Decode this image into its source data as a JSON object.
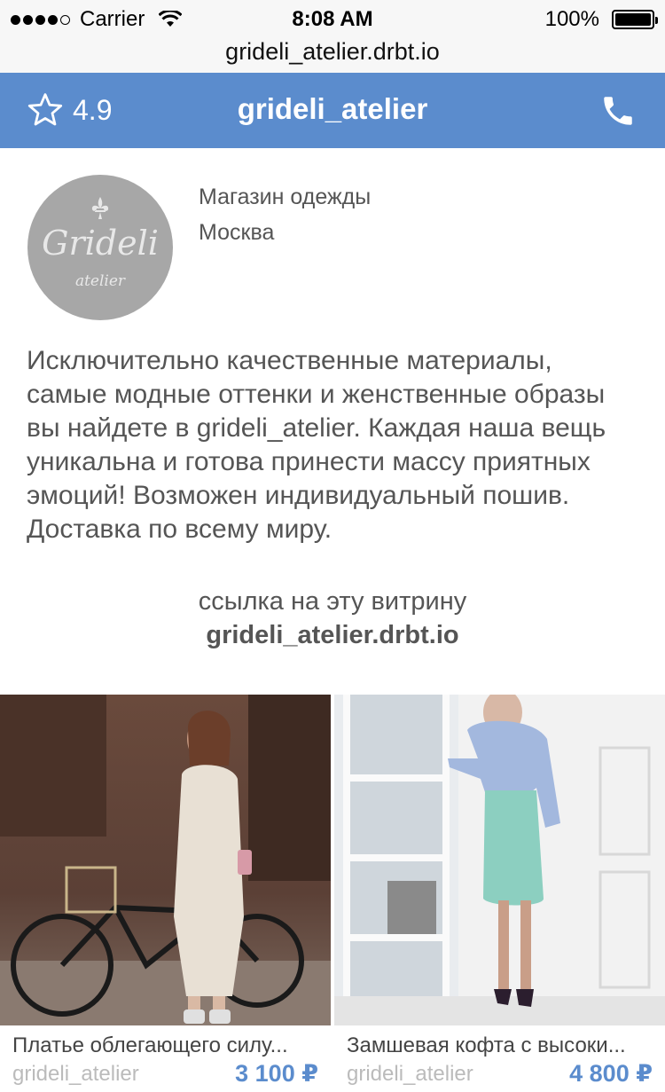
{
  "status_bar": {
    "carrier": "Carrier",
    "time": "8:08 AM",
    "battery": "100%"
  },
  "url": "grideli_atelier.drbt.io",
  "header": {
    "rating": "4.9",
    "title": "grideli_atelier",
    "accent_color": "#5b8ccd"
  },
  "profile": {
    "logo_text": "Grideli",
    "logo_subtext": "atelier",
    "category": "Магазин одежды",
    "city": "Москва"
  },
  "description": "Исключительно качественные материалы, самые модные оттенки и женственные образы вы найдете в grideli_atelier. Каждая наша вещь уникальна и готова принести массу приятных эмоций! Возможен индивидуальный пошив. Доставка по всему миру.",
  "share": {
    "caption": "ссылка на эту витрину",
    "url": "grideli_atelier.drbt.io"
  },
  "products": [
    {
      "name": "Платье облегающего силу...",
      "shop": "grideli_atelier",
      "price": "3 100 ₽"
    },
    {
      "name": "Замшевая кофта с высоки...",
      "shop": "grideli_atelier",
      "price": "4 800 ₽"
    }
  ]
}
